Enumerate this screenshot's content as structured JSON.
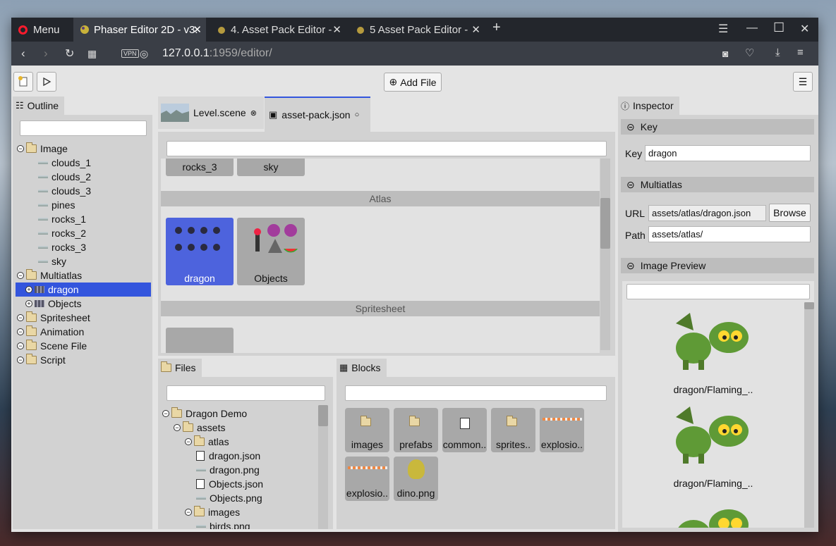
{
  "browser": {
    "menu_label": "Menu",
    "tabs": [
      {
        "label": "Phaser Editor 2D - v3.",
        "active": true
      },
      {
        "label": "4. Asset Pack Editor -",
        "active": false
      },
      {
        "label": "5  Asset Pack Editor -",
        "active": false
      }
    ],
    "address_host": "127.0.0.1",
    "address_rest": ":1959/editor/",
    "vpn_label": "VPN"
  },
  "toolbar": {
    "add_file_label": "Add File"
  },
  "outline": {
    "tab_label": "Outline",
    "search_placeholder": "",
    "items": [
      {
        "label": "Image",
        "level": 0,
        "type": "folder",
        "expanded": true
      },
      {
        "label": "clouds_1",
        "level": 1,
        "type": "image"
      },
      {
        "label": "clouds_2",
        "level": 1,
        "type": "image"
      },
      {
        "label": "clouds_3",
        "level": 1,
        "type": "image"
      },
      {
        "label": "pines",
        "level": 1,
        "type": "image"
      },
      {
        "label": "rocks_1",
        "level": 1,
        "type": "image"
      },
      {
        "label": "rocks_2",
        "level": 1,
        "type": "image"
      },
      {
        "label": "rocks_3",
        "level": 1,
        "type": "image"
      },
      {
        "label": "sky",
        "level": 1,
        "type": "image"
      },
      {
        "label": "Multiatlas",
        "level": 0,
        "type": "folder",
        "expanded": true
      },
      {
        "label": "dragon",
        "level": 1,
        "type": "atlas",
        "selected": true
      },
      {
        "label": "Objects",
        "level": 1,
        "type": "atlas"
      },
      {
        "label": "Spritesheet",
        "level": 0,
        "type": "folder"
      },
      {
        "label": "Animation",
        "level": 0,
        "type": "folder"
      },
      {
        "label": "Scene File",
        "level": 0,
        "type": "folder"
      },
      {
        "label": "Script",
        "level": 0,
        "type": "folder"
      }
    ]
  },
  "editor": {
    "tabs": [
      {
        "label": "Level.scene",
        "active": false
      },
      {
        "label": "asset-pack.json",
        "active": true
      }
    ],
    "top_cells": [
      "rocks_3",
      "sky"
    ],
    "sections": [
      {
        "title": "Atlas",
        "items": [
          "dragon",
          "Objects"
        ]
      },
      {
        "title": "Spritesheet",
        "items": [
          ""
        ]
      }
    ]
  },
  "files": {
    "tab_label": "Files",
    "items": [
      {
        "label": "Dragon Demo",
        "level": 0,
        "type": "folder"
      },
      {
        "label": "assets",
        "level": 1,
        "type": "folder"
      },
      {
        "label": "atlas",
        "level": 2,
        "type": "folder"
      },
      {
        "label": "dragon.json",
        "level": 3,
        "type": "file"
      },
      {
        "label": "dragon.png",
        "level": 3,
        "type": "image"
      },
      {
        "label": "Objects.json",
        "level": 3,
        "type": "file"
      },
      {
        "label": "Objects.png",
        "level": 3,
        "type": "image"
      },
      {
        "label": "images",
        "level": 2,
        "type": "folder"
      },
      {
        "label": "birds.png",
        "level": 3,
        "type": "image"
      }
    ]
  },
  "blocks": {
    "tab_label": "Blocks",
    "items": [
      "images",
      "prefabs",
      "common..",
      "sprites..",
      "explosio..",
      "explosio..",
      "dino.png"
    ]
  },
  "inspector": {
    "tab_label": "Inspector",
    "key_section": "Key",
    "key_label": "Key",
    "key_value": "dragon",
    "multiatlas_section": "Multiatlas",
    "url_label": "URL",
    "url_value": "assets/atlas/dragon.json",
    "browse_label": "Browse",
    "path_label": "Path",
    "path_value": "assets/atlas/",
    "preview_section": "Image Preview",
    "preview_items": [
      "dragon/Flaming_..",
      "dragon/Flaming_.."
    ]
  },
  "colors": {
    "selection": "#3355dd",
    "tab_bar": "#23262c",
    "panel": "#d2d2d2"
  }
}
